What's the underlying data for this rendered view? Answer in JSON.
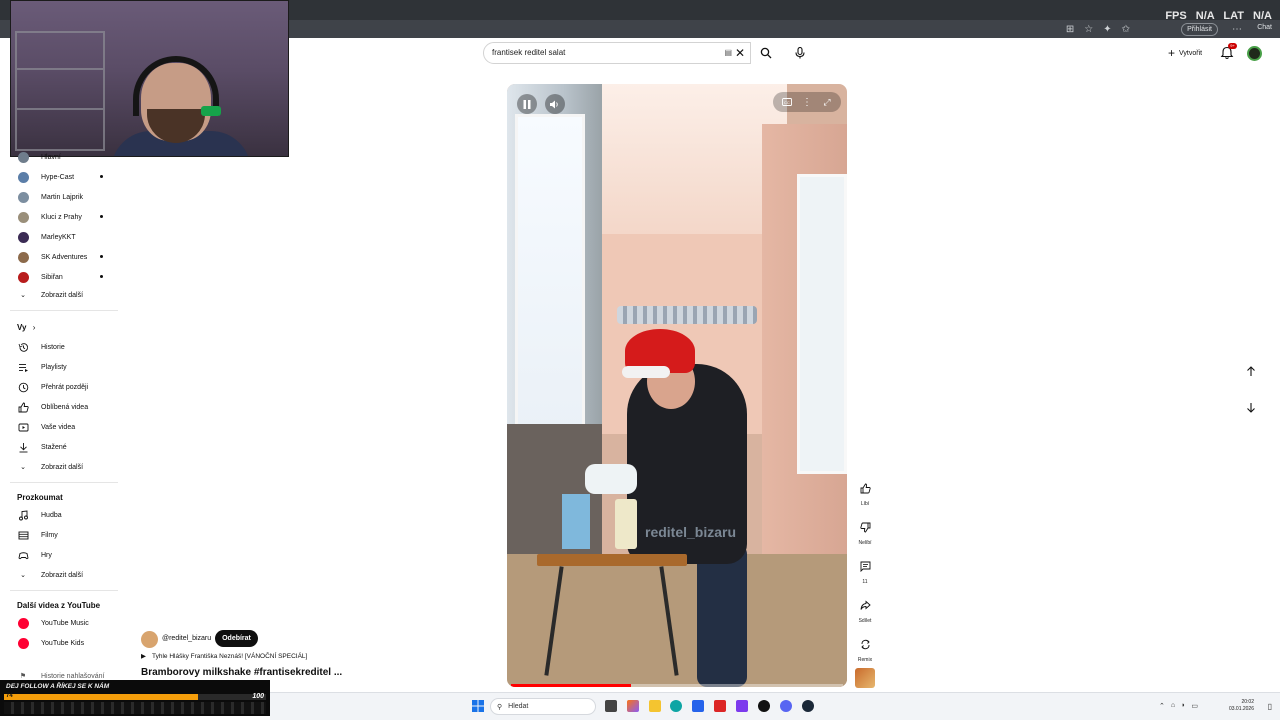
{
  "browser": {
    "overlay_fps_label": "FPS",
    "overlay_fps_value": "N/A",
    "overlay_lat_label": "LAT",
    "overlay_lat_value": "N/A",
    "signin_label": "Přihlásit",
    "chat_label": "Chat"
  },
  "header": {
    "search_query": "frantisek reditel salat",
    "create_label": "Vytvořit",
    "notification_badge": "9+"
  },
  "sidebar": {
    "partial_label": "Hlavní",
    "subscriptions": [
      {
        "label": "Hype-Cast",
        "avatar_color": "#5b7ea8",
        "dot": true
      },
      {
        "label": "Martin Lajprik",
        "avatar_color": "#7c8ea0",
        "dot": false
      },
      {
        "label": "Kluci z Prahy",
        "avatar_color": "#9a8f7a",
        "dot": true
      },
      {
        "label": "MarleyKKT",
        "avatar_color": "#3b2b54",
        "dot": false
      },
      {
        "label": "SK Adventures",
        "avatar_color": "#8c6a4b",
        "dot": true
      },
      {
        "label": "Sibiřan",
        "avatar_color": "#b81c1c",
        "dot": true
      }
    ],
    "subs_show_more": "Zobrazit další",
    "you_header": "Vy",
    "you_items": [
      {
        "label": "Historie",
        "icon": "history-icon"
      },
      {
        "label": "Playlisty",
        "icon": "playlists-icon"
      },
      {
        "label": "Přehrát později",
        "icon": "watch-later-icon"
      },
      {
        "label": "Oblíbená videa",
        "icon": "liked-icon"
      },
      {
        "label": "Vaše videa",
        "icon": "your-videos-icon"
      },
      {
        "label": "Stažené",
        "icon": "download-icon"
      }
    ],
    "you_show_more": "Zobrazit další",
    "explore_header": "Prozkoumat",
    "explore_items": [
      {
        "label": "Hudba",
        "icon": "music-icon"
      },
      {
        "label": "Filmy",
        "icon": "movies-icon"
      },
      {
        "label": "Hry",
        "icon": "gaming-icon"
      }
    ],
    "explore_show_more": "Zobrazit další",
    "more_header": "Další videa z YouTube",
    "more_items": [
      {
        "label": "YouTube Music",
        "color": "#ff0033"
      },
      {
        "label": "YouTube Kids",
        "color": "#ff0033"
      }
    ],
    "cut_item": "Historie nahlašování"
  },
  "video": {
    "progress": 0.36,
    "watermark": "reditel_bizaru"
  },
  "actions": {
    "like": "Líbí",
    "dislike": "Nelíbí",
    "comments": "11",
    "share": "Sdílet",
    "remix": "Remix"
  },
  "channel": {
    "handle": "@reditel_bizaru",
    "subscribe_label": "Odebírat",
    "playlist_text": "Tyhle Hlášky Františka Neznáš! [VÁNOČNÍ SPECIÁL]",
    "title": "Bramborovy milkshake #frantisekreditel ..."
  },
  "follow_overlay": {
    "text": "DEJ FOLLOW A ŘÍKEJ SE K NÁM",
    "count": "74",
    "goal": "100",
    "progress": 0.74
  },
  "taskbar": {
    "search_placeholder": "Hledat",
    "time": "20:02",
    "date": "03.01.2026"
  }
}
